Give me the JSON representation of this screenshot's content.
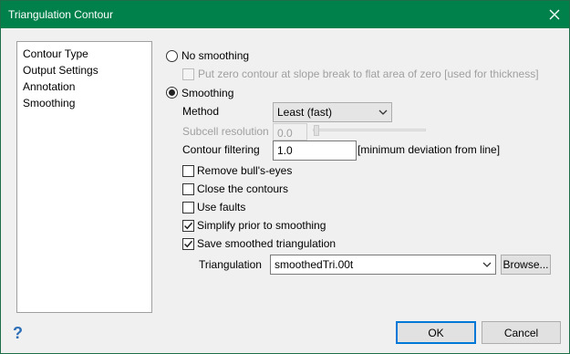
{
  "window": {
    "title": "Triangulation Contour"
  },
  "nav": {
    "items": [
      {
        "label": "Contour Type"
      },
      {
        "label": "Output Settings"
      },
      {
        "label": "Annotation"
      },
      {
        "label": "Smoothing"
      }
    ]
  },
  "smoothing": {
    "no_smoothing": {
      "label": "No smoothing",
      "checked": false
    },
    "zero_contour": {
      "label": "Put zero contour at slope break to flat area of zero [used for thickness]",
      "checked": false,
      "enabled": false
    },
    "smoothing": {
      "label": "Smoothing",
      "checked": true
    },
    "method": {
      "label": "Method",
      "value": "Least (fast)"
    },
    "subcell": {
      "label": "Subcell resolution",
      "value": "0.0",
      "enabled": false
    },
    "contour_filtering": {
      "label": "Contour filtering",
      "value": "1.0",
      "suffix": "[minimum deviation from line]"
    },
    "options": [
      {
        "label": "Remove bull's-eyes",
        "checked": false
      },
      {
        "label": "Close the contours",
        "checked": false
      },
      {
        "label": "Use faults",
        "checked": false
      },
      {
        "label": "Simplify prior to smoothing",
        "checked": true
      },
      {
        "label": "Save smoothed triangulation",
        "checked": true
      }
    ],
    "triangulation": {
      "label": "Triangulation",
      "value": "smoothedTri.00t",
      "browse_label": "Browse..."
    }
  },
  "footer": {
    "help_label": "?",
    "ok_label": "OK",
    "cancel_label": "Cancel"
  },
  "colors": {
    "titlebar": "#00804a",
    "accent": "#0078d7"
  },
  "icons": {
    "close": "close-icon",
    "help": "help-icon",
    "dropdown": "chevron-down-icon",
    "check": "check-icon"
  }
}
